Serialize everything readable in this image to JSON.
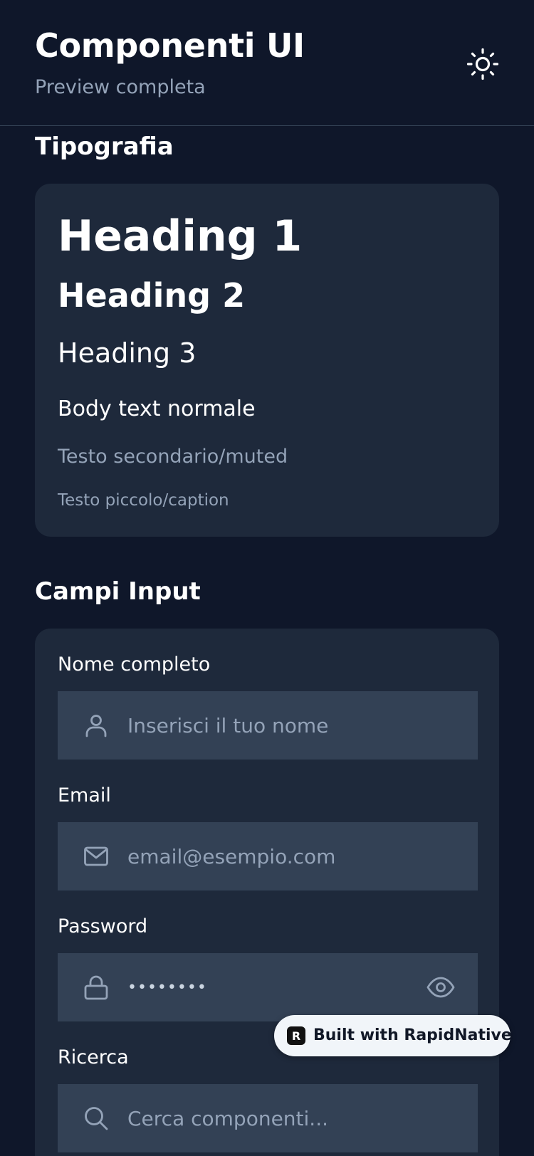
{
  "header": {
    "title": "Componenti UI",
    "subtitle": "Preview completa",
    "theme_toggle_icon": "sun-icon"
  },
  "typography": {
    "section_title": "Tipografia",
    "heading1": "Heading 1",
    "heading2": "Heading 2",
    "heading3": "Heading 3",
    "body": "Body text normale",
    "muted": "Testo secondario/muted",
    "caption": "Testo piccolo/caption"
  },
  "inputs": {
    "section_title": "Campi Input",
    "name": {
      "label": "Nome completo",
      "placeholder": "Inserisci il tuo nome",
      "icon": "user-icon"
    },
    "email": {
      "label": "Email",
      "placeholder": "email@esempio.com",
      "icon": "mail-icon"
    },
    "password": {
      "label": "Password",
      "value": "••••••••",
      "icon": "lock-icon",
      "toggle_icon": "eye-icon"
    },
    "search": {
      "label": "Ricerca",
      "placeholder": "Cerca componenti...",
      "icon": "search-icon"
    }
  },
  "badge": {
    "label": "Built with RapidNative",
    "logo": "R"
  },
  "colors": {
    "background": "#0f172a",
    "card": "#1e293b",
    "input": "#334155",
    "muted_text": "#94a3b8",
    "text": "#ffffff"
  }
}
